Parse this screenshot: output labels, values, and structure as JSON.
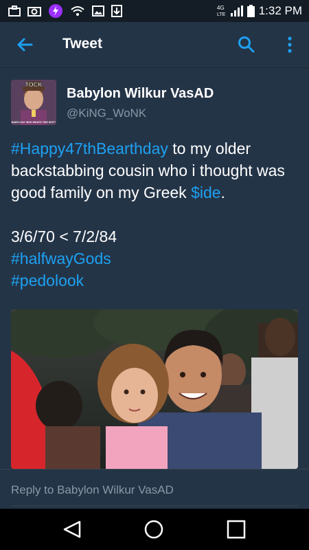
{
  "status_bar": {
    "time": "1:32 PM",
    "icons": [
      "briefcase-icon",
      "camera-icon",
      "messenger-icon",
      "wifi-icon",
      "image-icon",
      "download-icon",
      "lte-icon",
      "signal-icon",
      "battery-icon"
    ]
  },
  "app_bar": {
    "title": "Tweet",
    "back_icon": "arrow-back-icon",
    "search_icon": "search-icon",
    "more_icon": "more-vertical-icon"
  },
  "tweet": {
    "author_name": "Babylon Wilkur VasAD",
    "author_handle": "@KiNG_WoNK",
    "avatar_caption_top": "TOCK",
    "avatar_caption_bottom": "BABYLON? WHO WHATS THIS SHIT?",
    "text": {
      "hashtag1": "#Happy47thBearthday",
      "part1": " to my older backstabbing cousin who i thought was good family on my Greek ",
      "cashtag": "$ide",
      "part2": ".",
      "dates": "3/6/70 < 7/2/84",
      "hashtag2": "#halfwayGods",
      "hashtag3": "#pedolook"
    },
    "colors": {
      "link": "#1da1f2",
      "background": "#243447",
      "secondary_text": "#8899a6"
    }
  },
  "reply": {
    "placeholder": "Reply to Babylon Wilkur VasAD"
  },
  "nav_bar": {
    "back_icon": "nav-back-icon",
    "home_icon": "nav-home-icon",
    "recents_icon": "nav-recents-icon"
  }
}
